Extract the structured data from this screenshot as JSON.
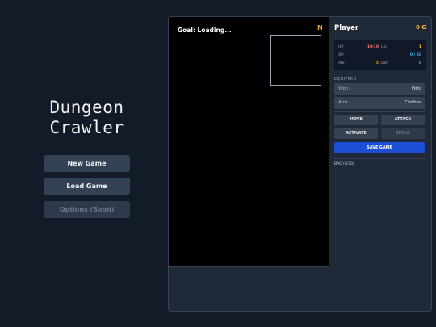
{
  "menu": {
    "title_line1": "Dungeon",
    "title_line2": "Crawler",
    "new_game": "New Game",
    "load_game": "Load Game",
    "options": "Options (Soon)"
  },
  "viewport": {
    "goal": "Goal: Loading...",
    "compass": "N"
  },
  "panel": {
    "player_name": "Player",
    "gold": "0 G",
    "stats": {
      "hp_label": "HP:",
      "hp_value": "10/10",
      "lvl_label": "Lvl:",
      "lvl_value": "1",
      "xp_label": "XP:",
      "xp_value": "0 / 50",
      "atk_label": "Atk:",
      "atk_value": "5",
      "def_label": "Def:",
      "def_value": "0"
    },
    "equipped_title": "EQUIPPED",
    "weapon_label": "Wpn:",
    "weapon_value": "Fists",
    "armor_label": "Arm:",
    "armor_value": "Clothes",
    "actions": {
      "move": "MOVE",
      "attack": "ATTACK",
      "activate": "ACTIVATE",
      "speak": "SPEAK"
    },
    "save_game": "SAVE GAME",
    "bag": "BAG (0/30)"
  },
  "colors": {
    "hp": "#f87171",
    "xp": "#38bdf8",
    "atk": "#f59e0b",
    "def": "#38bdf8",
    "lvl": "#facc15",
    "accent": "#1d4ed8",
    "gold": "#f5b83a"
  }
}
